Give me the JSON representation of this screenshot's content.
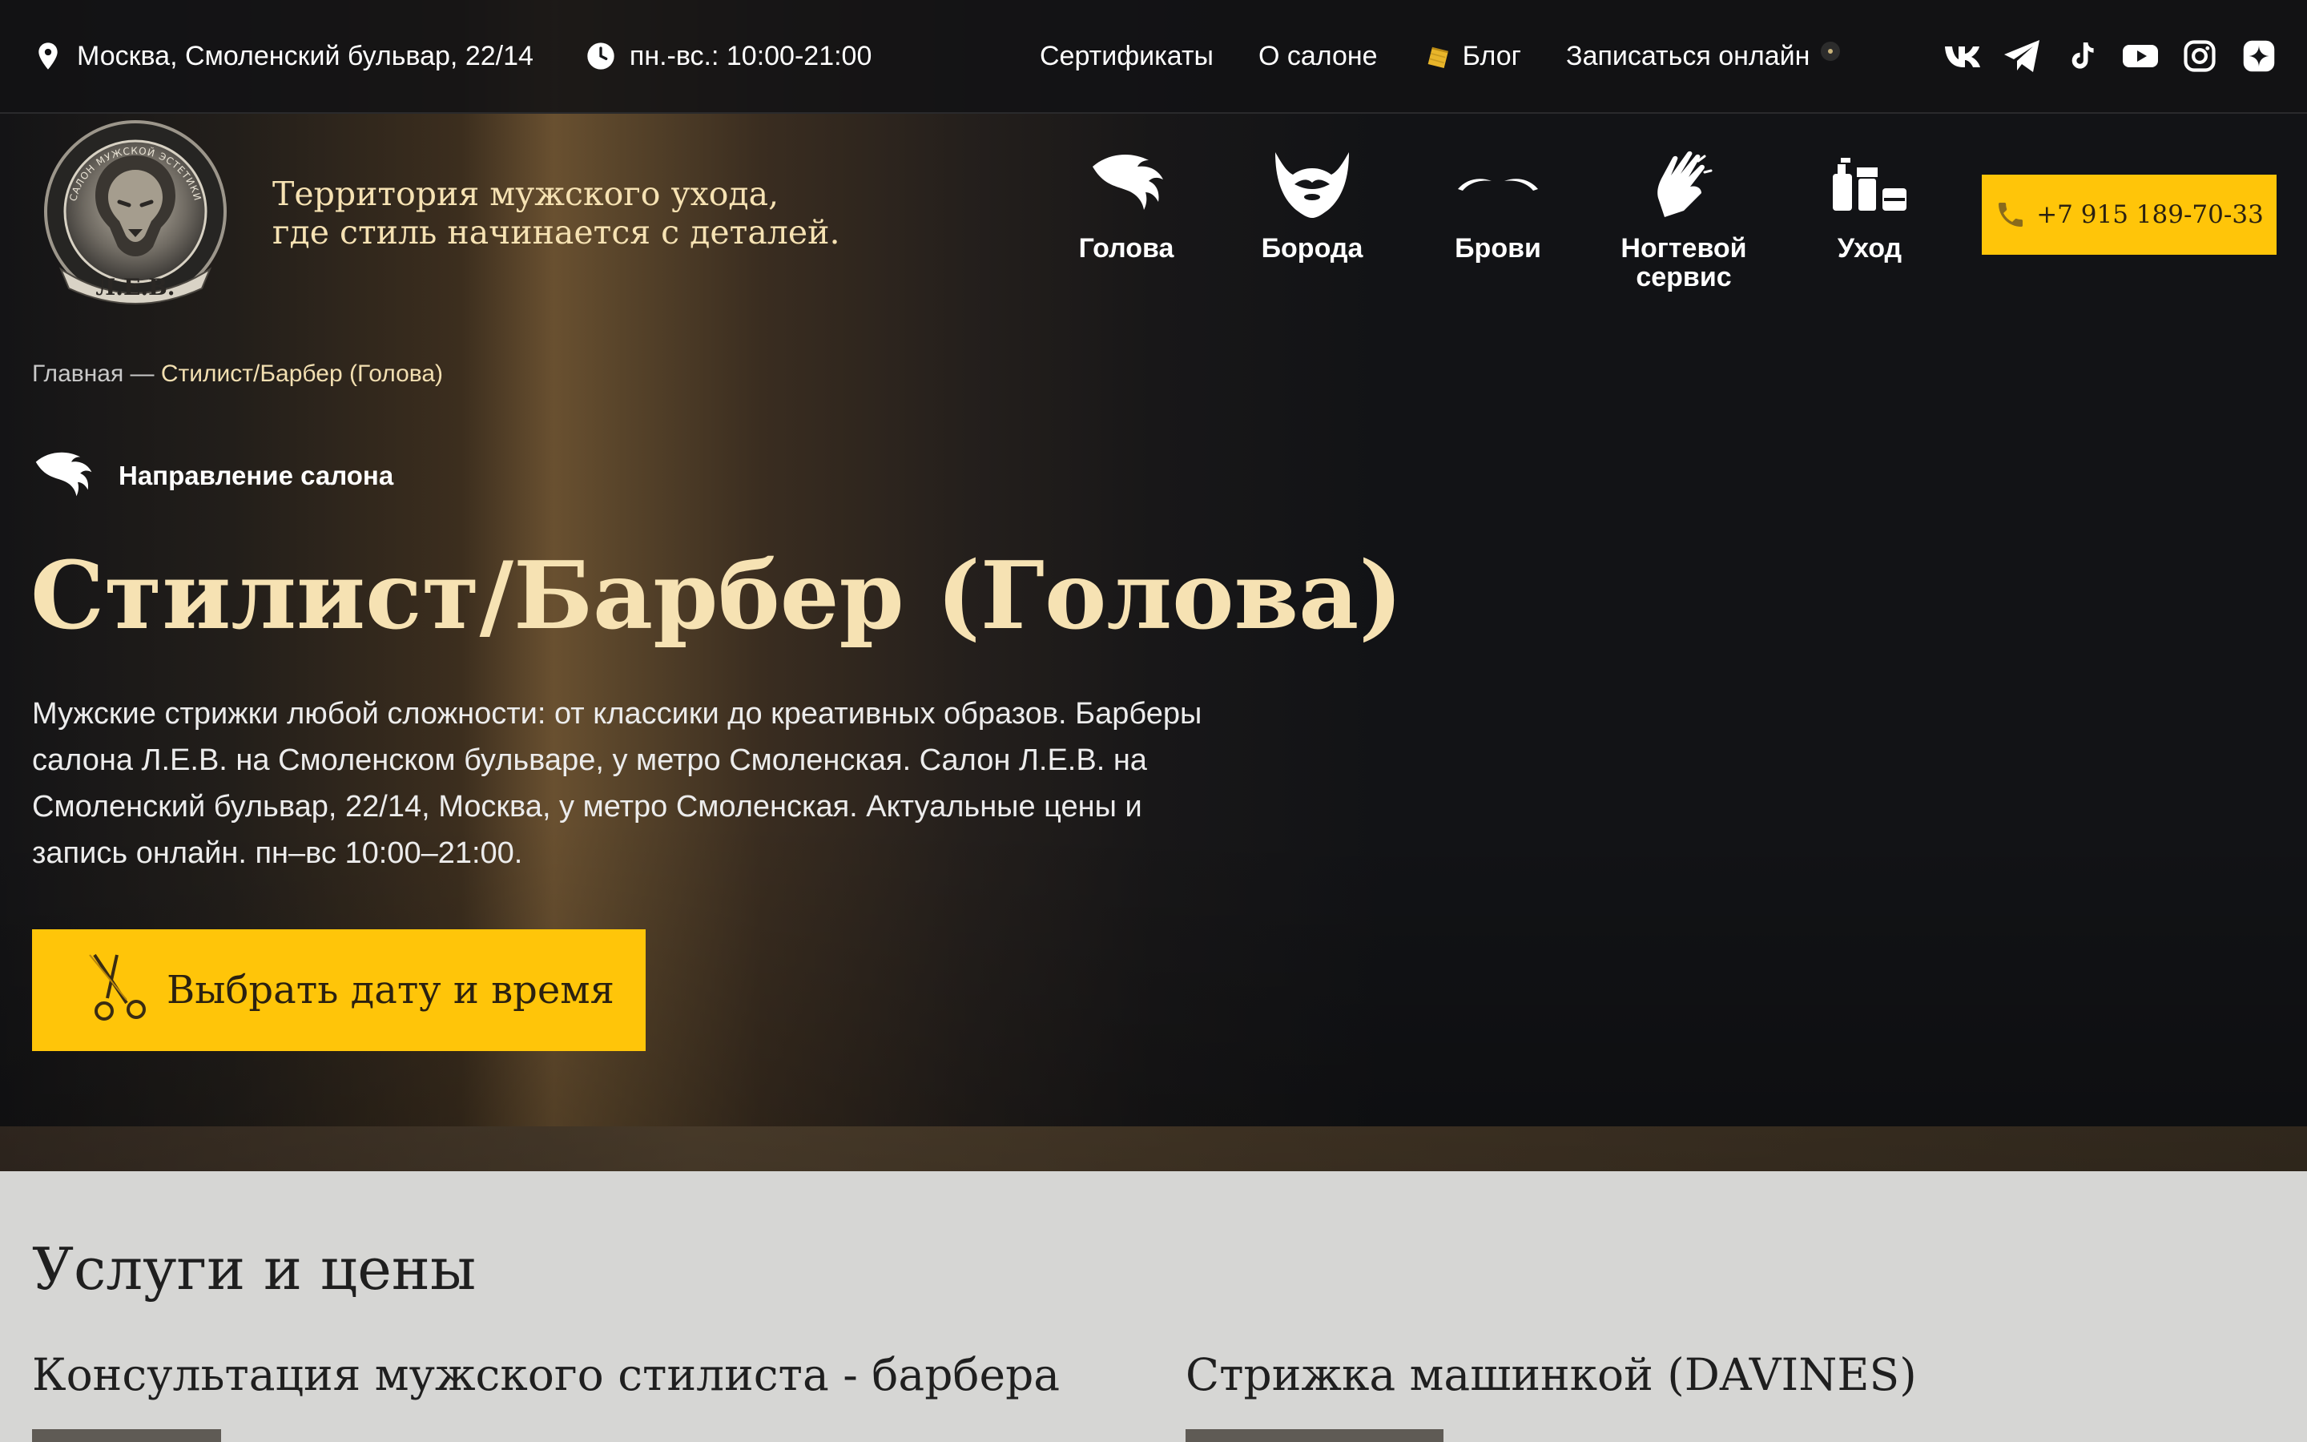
{
  "topbar": {
    "address": "Москва, Смоленский бульвар, 22/14",
    "hours": "пн.-вс.: 10:00-21:00",
    "nav": {
      "certificates": "Сертификаты",
      "about": "О салоне",
      "blog": "Блог",
      "book_online": "Записаться онлайн"
    },
    "socials": [
      "vk-icon",
      "telegram-icon",
      "tiktok-icon",
      "youtube-icon",
      "instagram-icon",
      "zen-icon"
    ]
  },
  "header": {
    "logo_text": "САЛОН МУЖСКОЙ ЭСТЕТИКИ",
    "logo_brand": "Л.Е.В.",
    "tagline_line1": "Территория мужского ухода,",
    "tagline_line2": "где стиль начинается с деталей.",
    "categories": [
      {
        "label": "Голова",
        "icon": "hair-icon"
      },
      {
        "label": "Борода",
        "icon": "beard-icon"
      },
      {
        "label": "Брови",
        "icon": "eyebrows-icon"
      },
      {
        "label": "Ногтевой сервис",
        "icon": "hands-icon"
      },
      {
        "label": "Уход",
        "icon": "care-products-icon"
      }
    ],
    "phone": "+7 915 189-70-33"
  },
  "breadcrumbs": {
    "home": "Главная",
    "separator": " — ",
    "current": "Стилист/Барбер (Голова)"
  },
  "direction": {
    "label": "Направление салона"
  },
  "page": {
    "title": "Стилист/Барбер (Голова)",
    "description": "Мужские стрижки любой сложности: от классики до креативных образов. Барберы салона Л.Е.В. на Смоленском бульваре, у метро Смоленская. Салон Л.Е.В. на Смоленский бульвар, 22/14, Москва, у метро Смоленская. Актуальные цены и запись онлайн. пн–вс 10:00–21:00.",
    "cta_label": "Выбрать дату и время"
  },
  "services": {
    "heading": "Услуги и цены",
    "items": [
      {
        "name": "Консультация мужского стилиста - барбера"
      },
      {
        "name": "Стрижка машинкой (DAVINES)"
      }
    ]
  },
  "colors": {
    "accent": "#ffc509",
    "cream": "#f6e2b3",
    "background": "#121316",
    "services_bg": "#d6d6d4"
  }
}
